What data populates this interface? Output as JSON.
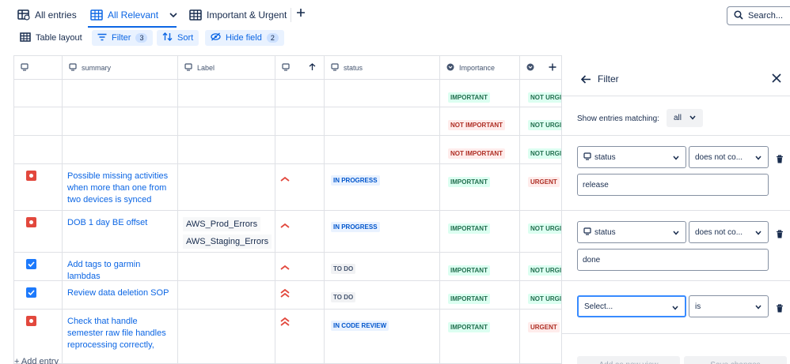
{
  "tabs": [
    {
      "label": "All entries"
    },
    {
      "label": "All Relevant"
    },
    {
      "label": "Important & Urgent"
    }
  ],
  "search": {
    "placeholder": "Search..."
  },
  "toolbar": {
    "table_layout": "Table layout",
    "filter": "Filter",
    "filter_count": "3",
    "sort": "Sort",
    "hide_field": "Hide field",
    "hide_count": "2"
  },
  "columns": {
    "summary": "summary",
    "label": "Label",
    "status": "status",
    "importance": "Importance"
  },
  "rows": [
    {
      "summary": "",
      "labels": [],
      "status": "",
      "importance": "IMPORTANT",
      "urgency": "NOT URGI"
    },
    {
      "summary": "",
      "labels": [],
      "status": "",
      "importance": "NOT IMPORTANT",
      "urgency": "NOT URGI"
    },
    {
      "summary": "",
      "labels": [],
      "status": "",
      "importance": "NOT IMPORTANT",
      "urgency": "NOT URGI"
    },
    {
      "summary": "Possible missing activities when more than one from two devices is synced",
      "labels": [],
      "status": "IN PROGRESS",
      "importance": "IMPORTANT",
      "urgency": "URGENT"
    },
    {
      "summary": "DOB 1 day BE offset",
      "labels": [
        "AWS_Prod_Errors",
        "AWS_Staging_Errors"
      ],
      "status": "IN PROGRESS",
      "importance": "IMPORTANT",
      "urgency": "NOT URGI"
    },
    {
      "summary": "Add tags to garmin lambdas",
      "labels": [],
      "status": "TO DO",
      "importance": "IMPORTANT",
      "urgency": "NOT URGI"
    },
    {
      "summary": "Review data deletion SOP",
      "labels": [],
      "status": "TO DO",
      "importance": "IMPORTANT",
      "urgency": "NOT URGI"
    },
    {
      "summary": "Check that handle semester raw file handles reprocessing correctly,",
      "labels": [],
      "status": "IN CODE REVIEW",
      "importance": "IMPORTANT",
      "urgency": "URGENT"
    }
  ],
  "add_entry": "+ Add entry",
  "filter_panel": {
    "title": "Filter",
    "show_matching": "Show entries matching:",
    "match_mode": "all",
    "rules": [
      {
        "field": "status",
        "operator": "does not co...",
        "value": "release"
      },
      {
        "field": "status",
        "operator": "does not co...",
        "value": "done"
      },
      {
        "field": "Select...",
        "operator": "is",
        "value": ""
      }
    ],
    "add_view": "Add as new view",
    "save": "Save changes"
  }
}
